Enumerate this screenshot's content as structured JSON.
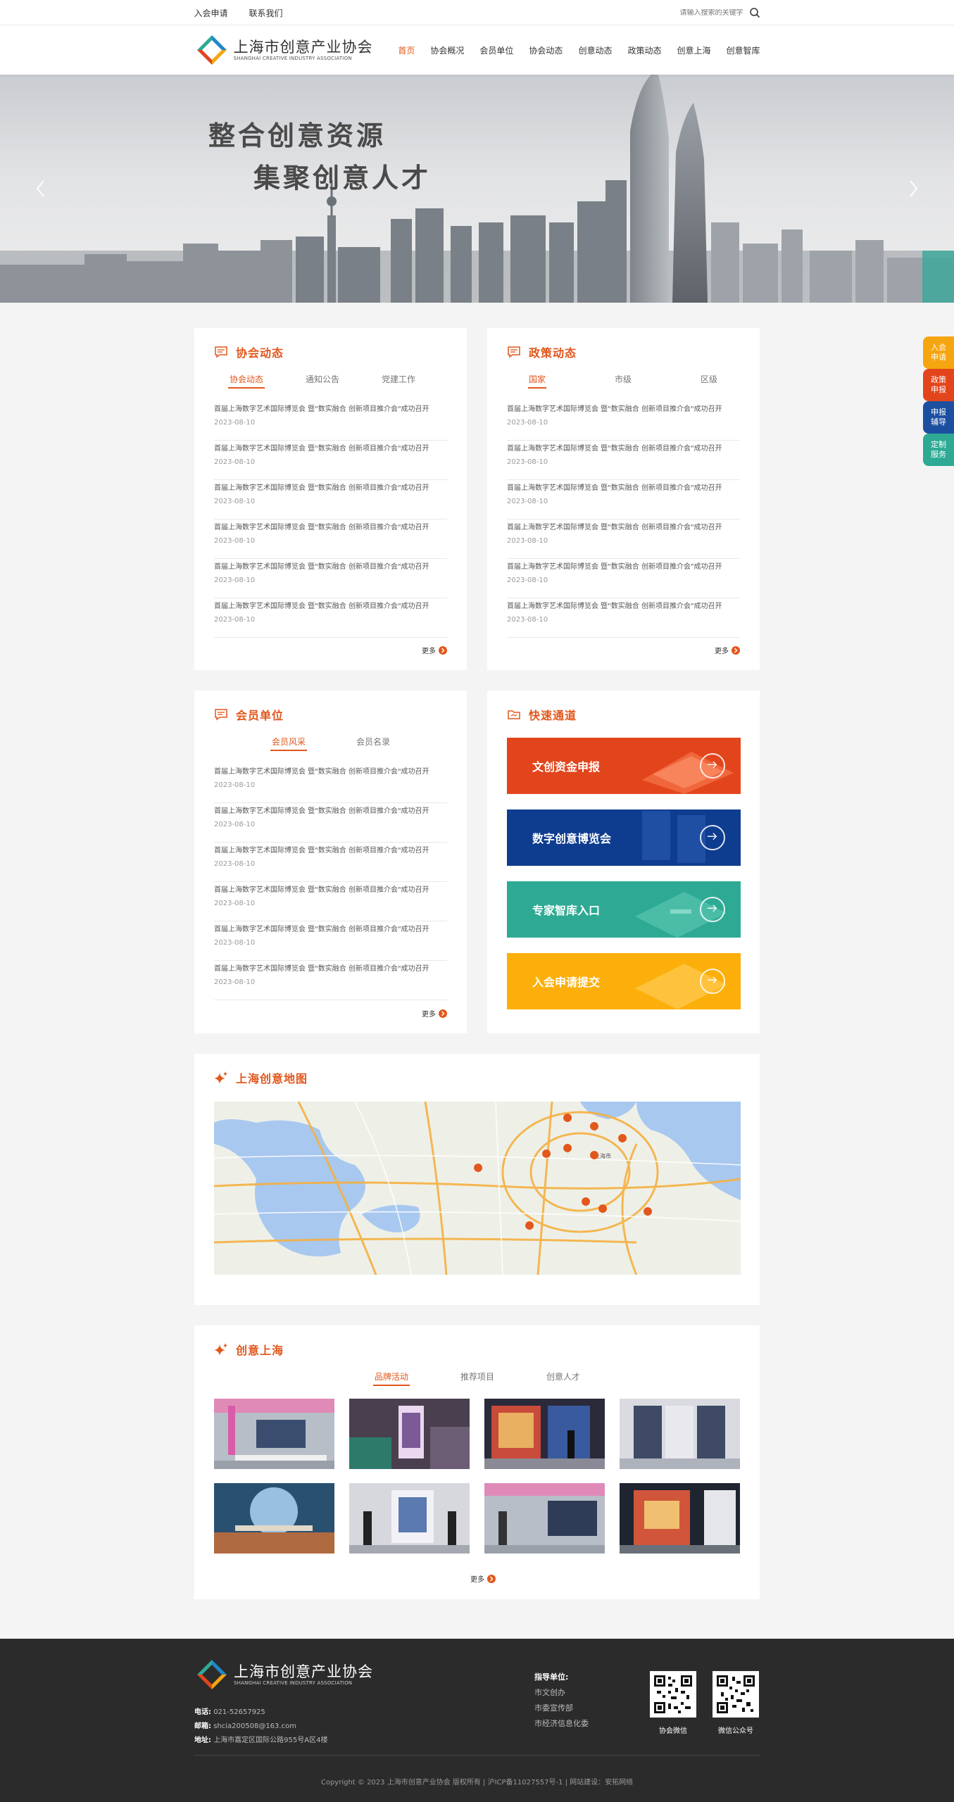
{
  "topbar": {
    "links": [
      "入会申请",
      "联系我们"
    ],
    "search_placeholder": "请输入搜索的关键字"
  },
  "header": {
    "logo_cn": "上海市创意产业协会",
    "logo_en": "SHANGHAI CREATIVE INDUSTRY ASSOCIATION",
    "nav": [
      "首页",
      "协会概况",
      "会员单位",
      "协会动态",
      "创意动态",
      "政策动态",
      "创意上海",
      "创意智库"
    ],
    "active_nav": "首页"
  },
  "banner": {
    "line1": "整合创意资源",
    "line2": "集聚创意人才"
  },
  "side_tabs": [
    {
      "label": "入会申请",
      "color": "#f5a50f"
    },
    {
      "label": "政策申报",
      "color": "#e2451c"
    },
    {
      "label": "申报辅导",
      "color": "#1c4fa0"
    },
    {
      "label": "定制服务",
      "color": "#2eaa94"
    }
  ],
  "association_news": {
    "title": "协会动态",
    "tabs": [
      "协会动态",
      "通知公告",
      "党建工作"
    ],
    "items": [
      {
        "title": "首届上海数字艺术国际博览会 暨\"数实融合 创新项目推介会\"成功召开",
        "date": "2023-08-10"
      },
      {
        "title": "首届上海数字艺术国际博览会 暨\"数实融合 创新项目推介会\"成功召开",
        "date": "2023-08-10"
      },
      {
        "title": "首届上海数字艺术国际博览会 暨\"数实融合 创新项目推介会\"成功召开",
        "date": "2023-08-10"
      },
      {
        "title": "首届上海数字艺术国际博览会 暨\"数实融合 创新项目推介会\"成功召开",
        "date": "2023-08-10"
      },
      {
        "title": "首届上海数字艺术国际博览会 暨\"数实融合 创新项目推介会\"成功召开",
        "date": "2023-08-10"
      },
      {
        "title": "首届上海数字艺术国际博览会 暨\"数实融合 创新项目推介会\"成功召开",
        "date": "2023-08-10"
      }
    ],
    "more": "更多"
  },
  "policy_news": {
    "title": "政策动态",
    "tabs": [
      "国家",
      "市级",
      "区级"
    ],
    "items": [
      {
        "title": "首届上海数字艺术国际博览会 暨\"数实融合 创新项目推介会\"成功召开",
        "date": "2023-08-10"
      },
      {
        "title": "首届上海数字艺术国际博览会 暨\"数实融合 创新项目推介会\"成功召开",
        "date": "2023-08-10"
      },
      {
        "title": "首届上海数字艺术国际博览会 暨\"数实融合 创新项目推介会\"成功召开",
        "date": "2023-08-10"
      },
      {
        "title": "首届上海数字艺术国际博览会 暨\"数实融合 创新项目推介会\"成功召开",
        "date": "2023-08-10"
      },
      {
        "title": "首届上海数字艺术国际博览会 暨\"数实融合 创新项目推介会\"成功召开",
        "date": "2023-08-10"
      },
      {
        "title": "首届上海数字艺术国际博览会 暨\"数实融合 创新项目推介会\"成功召开",
        "date": "2023-08-10"
      }
    ],
    "more": "更多"
  },
  "members": {
    "title": "会员单位",
    "tabs": [
      "会员风采",
      "会员名录"
    ],
    "items": [
      {
        "title": "首届上海数字艺术国际博览会 暨\"数实融合 创新项目推介会\"成功召开",
        "date": "2023-08-10"
      },
      {
        "title": "首届上海数字艺术国际博览会 暨\"数实融合 创新项目推介会\"成功召开",
        "date": "2023-08-10"
      },
      {
        "title": "首届上海数字艺术国际博览会 暨\"数实融合 创新项目推介会\"成功召开",
        "date": "2023-08-10"
      },
      {
        "title": "首届上海数字艺术国际博览会 暨\"数实融合 创新项目推介会\"成功召开",
        "date": "2023-08-10"
      },
      {
        "title": "首届上海数字艺术国际博览会 暨\"数实融合 创新项目推介会\"成功召开",
        "date": "2023-08-10"
      },
      {
        "title": "首届上海数字艺术国际博览会 暨\"数实融合 创新项目推介会\"成功召开",
        "date": "2023-08-10"
      }
    ],
    "more": "更多"
  },
  "quick_access": {
    "title": "快速通道",
    "buttons": [
      {
        "label": "文创资金申报",
        "color": "#e2451c"
      },
      {
        "label": "数字创意博览会",
        "color": "#0e3d8f"
      },
      {
        "label": "专家智库入口",
        "color": "#2eaa94"
      },
      {
        "label": "入会申请提交",
        "color": "#fcaf0a"
      }
    ]
  },
  "creative_map": {
    "title": "上海创意地图",
    "map_labels": [
      "上海市"
    ]
  },
  "creative_shanghai": {
    "title": "创意上海",
    "tabs": [
      "品牌活动",
      "推荐项目",
      "创意人才"
    ],
    "more": "更多"
  },
  "footer": {
    "logo_cn": "上海市创意产业协会",
    "logo_en": "SHANGHAI CREATIVE INDUSTRY ASSOCIATION",
    "phone_label": "电话:",
    "phone": "021-52657925",
    "email_label": "邮箱:",
    "email": "shcia200508@163.com",
    "address_label": "地址:",
    "address": "上海市嘉定区国际公路955号A区4楼",
    "guide_title": "指导单位:",
    "guides": [
      "市文创办",
      "市委宣传部",
      "市经济信息化委"
    ],
    "qr_labels": [
      "协会微信",
      "微信公众号"
    ],
    "copyright": "Copyright © 2023 上海市创意产业协会 版权所有 | 沪ICP备11027557号-1 | 网站建设：安拓网络"
  },
  "colors": {
    "accent": "#e2571c",
    "footer_bg": "#2b2b2b"
  }
}
